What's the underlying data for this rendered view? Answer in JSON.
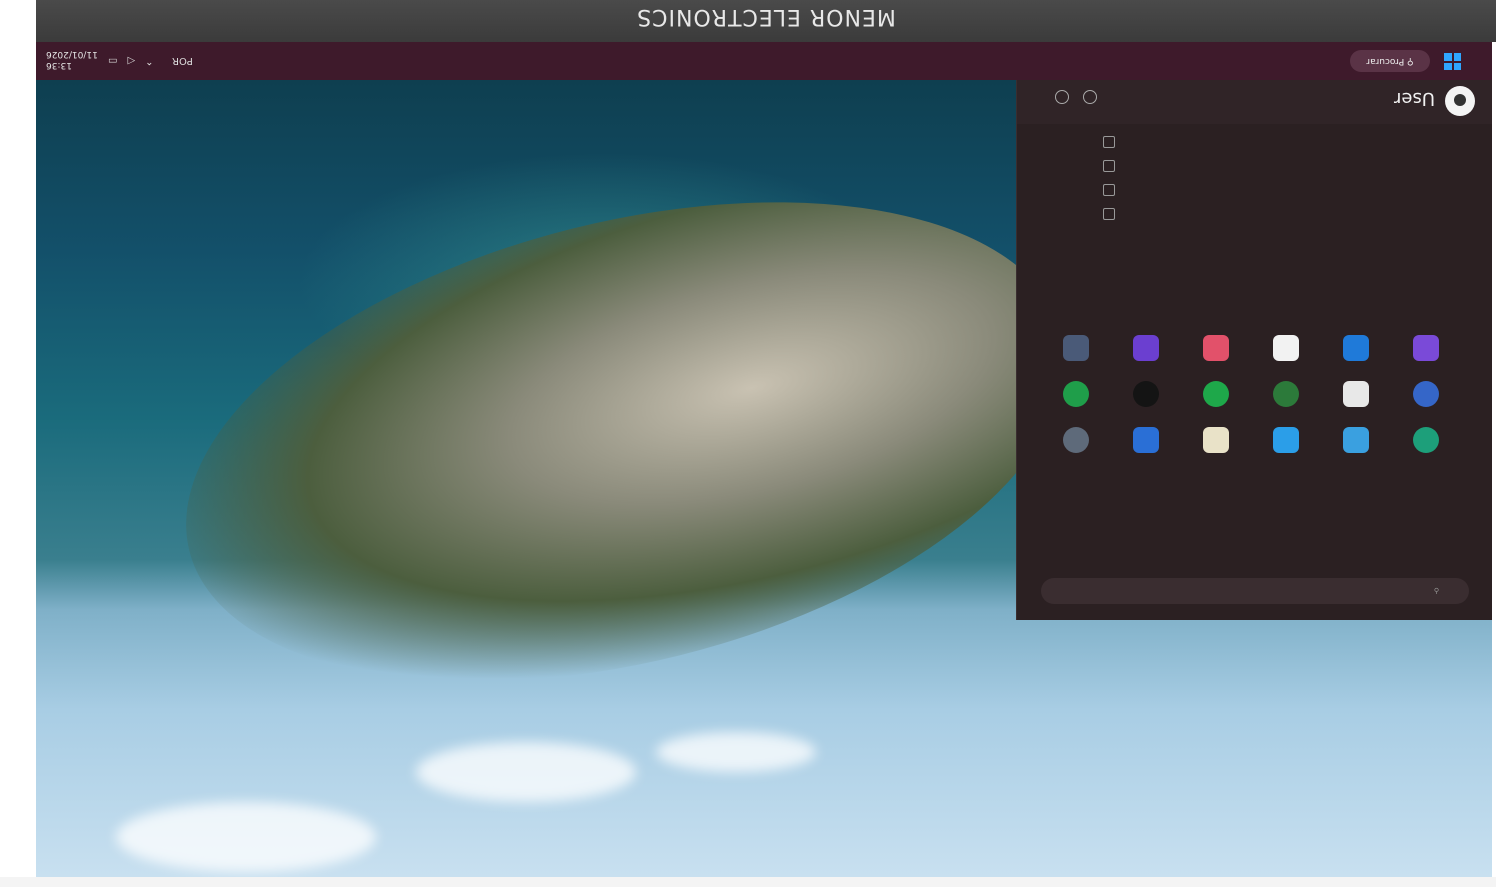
{
  "monitor": {
    "brand": "MENOR ELECTRONICS"
  },
  "taskbar": {
    "time": "13:36",
    "date": "11/01/2026",
    "language": "POR",
    "search_placeholder": "Procurar",
    "icons": [
      "windows-logo-icon",
      "wifi-icon",
      "volume-icon",
      "battery-icon"
    ]
  },
  "start_menu": {
    "user_name": "User"
  },
  "colors": {
    "taskbar": "#3e1a2b",
    "start_menu": "#2b2022",
    "accent": "#2fa6ff"
  }
}
